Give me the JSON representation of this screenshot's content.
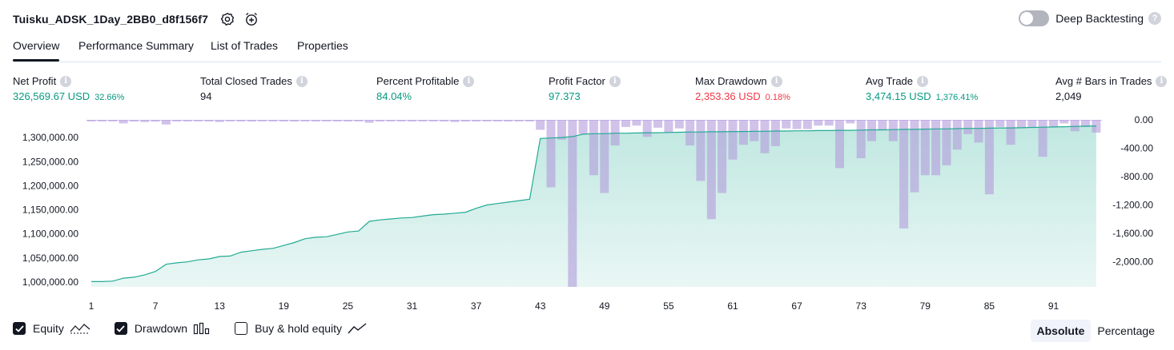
{
  "header": {
    "title": "Tuisku_ADSK_1Day_2BB0_d8f156f7"
  },
  "deep_backtesting": {
    "label": "Deep Backtesting",
    "enabled": false
  },
  "tabs": [
    {
      "label": "Overview",
      "active": true
    },
    {
      "label": "Performance Summary",
      "active": false
    },
    {
      "label": "List of Trades",
      "active": false
    },
    {
      "label": "Properties",
      "active": false
    }
  ],
  "metrics": [
    {
      "label": "Net Profit",
      "value": "326,569.67 USD",
      "pct": "32.66%",
      "tone": "pos"
    },
    {
      "label": "Total Closed Trades",
      "value": "94",
      "pct": "",
      "tone": "neu"
    },
    {
      "label": "Percent Profitable",
      "value": "84.04%",
      "pct": "",
      "tone": "pos"
    },
    {
      "label": "Profit Factor",
      "value": "97.373",
      "pct": "",
      "tone": "pos"
    },
    {
      "label": "Max Drawdown",
      "value": "2,353.36 USD",
      "pct": "0.18%",
      "tone": "neg"
    },
    {
      "label": "Avg Trade",
      "value": "3,474.15 USD",
      "pct": "1,376.41%",
      "tone": "pos"
    },
    {
      "label": "Avg # Bars in Trades",
      "value": "2,049",
      "pct": "",
      "tone": "neu"
    }
  ],
  "legend": {
    "equity": {
      "label": "Equity",
      "checked": true
    },
    "drawdown": {
      "label": "Drawdown",
      "checked": true
    },
    "buy_hold": {
      "label": "Buy & hold equity",
      "checked": false
    }
  },
  "mode": {
    "absolute": "Absolute",
    "percentage": "Percentage",
    "selected": "Absolute"
  },
  "colors": {
    "equity": "#22ab94",
    "drawdown": "#7e57c2",
    "positive": "#089981",
    "negative": "#f23645"
  },
  "chart_data": {
    "type": "area",
    "x_ticks": [
      "1",
      "7",
      "13",
      "19",
      "25",
      "31",
      "37",
      "43",
      "49",
      "55",
      "61",
      "67",
      "73",
      "79",
      "85",
      "91"
    ],
    "y_left_ticks": [
      "1,000,000.00",
      "1,050,000.00",
      "1,100,000.00",
      "1,150,000.00",
      "1,200,000.00",
      "1,250,000.00",
      "1,300,000.00"
    ],
    "y_right_ticks": [
      "0.00",
      "-400.00",
      "-800.00",
      "-1,200.00",
      "-1,600.00",
      "-2,000.00"
    ],
    "ylim_left": [
      990000,
      1340000
    ],
    "ylim_right": [
      -2353.36,
      0
    ],
    "series": [
      {
        "name": "Equity",
        "axis": "left",
        "x": [
          1,
          2,
          3,
          4,
          5,
          6,
          7,
          8,
          9,
          10,
          11,
          12,
          13,
          14,
          15,
          16,
          17,
          18,
          19,
          20,
          21,
          22,
          23,
          24,
          25,
          26,
          27,
          28,
          29,
          30,
          31,
          32,
          33,
          34,
          35,
          36,
          37,
          38,
          39,
          40,
          41,
          42,
          43,
          44,
          45,
          46,
          47,
          48,
          49,
          50,
          51,
          52,
          53,
          54,
          55,
          56,
          57,
          58,
          59,
          60,
          61,
          62,
          63,
          64,
          65,
          66,
          67,
          68,
          69,
          70,
          71,
          72,
          73,
          74,
          75,
          76,
          77,
          78,
          79,
          80,
          81,
          82,
          83,
          84,
          85,
          86,
          87,
          88,
          89,
          90,
          91,
          92,
          93,
          94,
          95
        ],
        "values": [
          1001000,
          1001000,
          1002000,
          1008000,
          1010000,
          1015000,
          1022000,
          1037000,
          1040000,
          1042000,
          1046000,
          1048000,
          1053000,
          1054000,
          1062000,
          1065000,
          1068000,
          1070000,
          1076000,
          1082000,
          1090000,
          1093000,
          1094000,
          1099000,
          1104000,
          1106000,
          1126000,
          1129000,
          1131000,
          1133000,
          1134000,
          1137000,
          1140000,
          1141000,
          1143000,
          1145000,
          1153000,
          1160000,
          1163000,
          1166000,
          1169000,
          1172000,
          1298000,
          1299000,
          1300000,
          1302000,
          1307000,
          1308000,
          1308000,
          1309000,
          1309000,
          1309500,
          1310000,
          1310000,
          1310500,
          1311000,
          1311500,
          1311500,
          1312000,
          1312000,
          1312500,
          1312500,
          1313000,
          1313000,
          1313500,
          1313500,
          1314000,
          1314000,
          1314500,
          1314500,
          1315000,
          1315000,
          1315500,
          1316000,
          1316000,
          1316500,
          1317000,
          1317000,
          1317500,
          1318000,
          1318000,
          1318500,
          1319000,
          1319000,
          1319500,
          1320000,
          1320000,
          1320500,
          1321000,
          1321500,
          1322000,
          1322500,
          1323000,
          1323500,
          1324000
        ]
      },
      {
        "name": "Drawdown",
        "axis": "right",
        "x": [
          1,
          2,
          3,
          4,
          5,
          6,
          7,
          8,
          9,
          10,
          11,
          12,
          13,
          14,
          15,
          16,
          17,
          18,
          19,
          20,
          21,
          22,
          23,
          24,
          25,
          26,
          27,
          28,
          29,
          30,
          31,
          32,
          33,
          34,
          35,
          36,
          37,
          38,
          39,
          40,
          41,
          42,
          43,
          44,
          45,
          46,
          47,
          48,
          49,
          50,
          51,
          52,
          53,
          54,
          55,
          56,
          57,
          58,
          59,
          60,
          61,
          62,
          63,
          64,
          65,
          66,
          67,
          68,
          69,
          70,
          71,
          72,
          73,
          74,
          75,
          76,
          77,
          78,
          79,
          80,
          81,
          82,
          83,
          84,
          85,
          86,
          87,
          88,
          89,
          90,
          91,
          92,
          93,
          94,
          95
        ],
        "values": [
          -5,
          -10,
          -15,
          -50,
          -25,
          -30,
          -25,
          -65,
          -20,
          -15,
          -20,
          -15,
          -30,
          -20,
          -10,
          -25,
          -15,
          -20,
          -20,
          -25,
          -15,
          -20,
          -15,
          -20,
          -15,
          -10,
          -40,
          -15,
          -10,
          -5,
          -10,
          -15,
          -20,
          -15,
          -30,
          -25,
          -15,
          -20,
          -10,
          -10,
          -10,
          -10,
          -140,
          -950,
          -280,
          -2353,
          -200,
          -780,
          -1030,
          -360,
          -100,
          -80,
          -240,
          -110,
          -180,
          -120,
          -360,
          -860,
          -1400,
          -1030,
          -560,
          -350,
          -300,
          -470,
          -370,
          -120,
          -130,
          -130,
          -80,
          -80,
          -680,
          -50,
          -540,
          -300,
          -150,
          -300,
          -1530,
          -1020,
          -780,
          -780,
          -640,
          -420,
          -200,
          -320,
          -1050,
          -100,
          -350,
          -120,
          -100,
          -520,
          -100,
          -50,
          -160,
          -100,
          -180
        ]
      }
    ],
    "xlabel": "",
    "ylabel": "",
    "grid": false
  }
}
